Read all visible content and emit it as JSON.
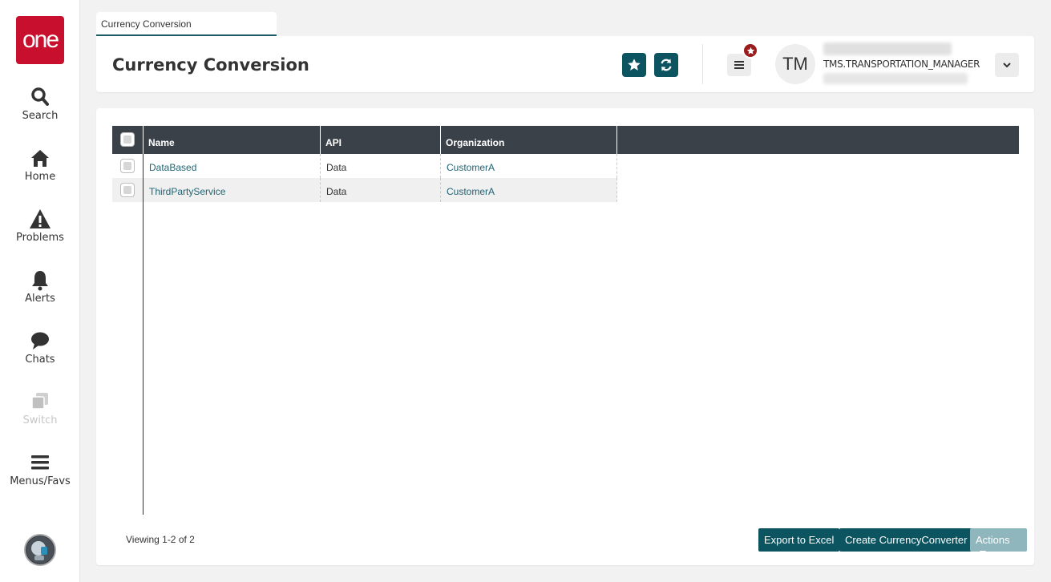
{
  "logo": {
    "text": "one"
  },
  "nav": [
    {
      "label": "Search",
      "icon": "search-icon"
    },
    {
      "label": "Home",
      "icon": "home-icon"
    },
    {
      "label": "Problems",
      "icon": "warning-icon"
    },
    {
      "label": "Alerts",
      "icon": "bell-icon"
    },
    {
      "label": "Chats",
      "icon": "chat-bubble-icon"
    },
    {
      "label": "Switch",
      "icon": "switch-icon"
    },
    {
      "label": "Menus/Favs",
      "icon": "hamburger-icon"
    }
  ],
  "tab": {
    "label": "Currency Conversion"
  },
  "header": {
    "title": "Currency Conversion",
    "user_initials": "TM",
    "username": "TMS.TRANSPORTATION_MANAGER"
  },
  "grid": {
    "columns": [
      "Name",
      "API",
      "Organization"
    ],
    "rows": [
      {
        "name": "DataBased",
        "api": "Data",
        "organization": "CustomerA"
      },
      {
        "name": "ThirdPartyService",
        "api": "Data",
        "organization": "CustomerA"
      }
    ]
  },
  "footer": {
    "viewing": "Viewing 1-2 of 2",
    "export_label": "Export to Excel",
    "create_label": "Create CurrencyConverter",
    "actions_label": "Actions"
  },
  "colors": {
    "brand_red": "#c8102e",
    "accent_teal": "#0d5461",
    "header_dark": "#3b4149",
    "badge_red": "#9b1c1c"
  }
}
